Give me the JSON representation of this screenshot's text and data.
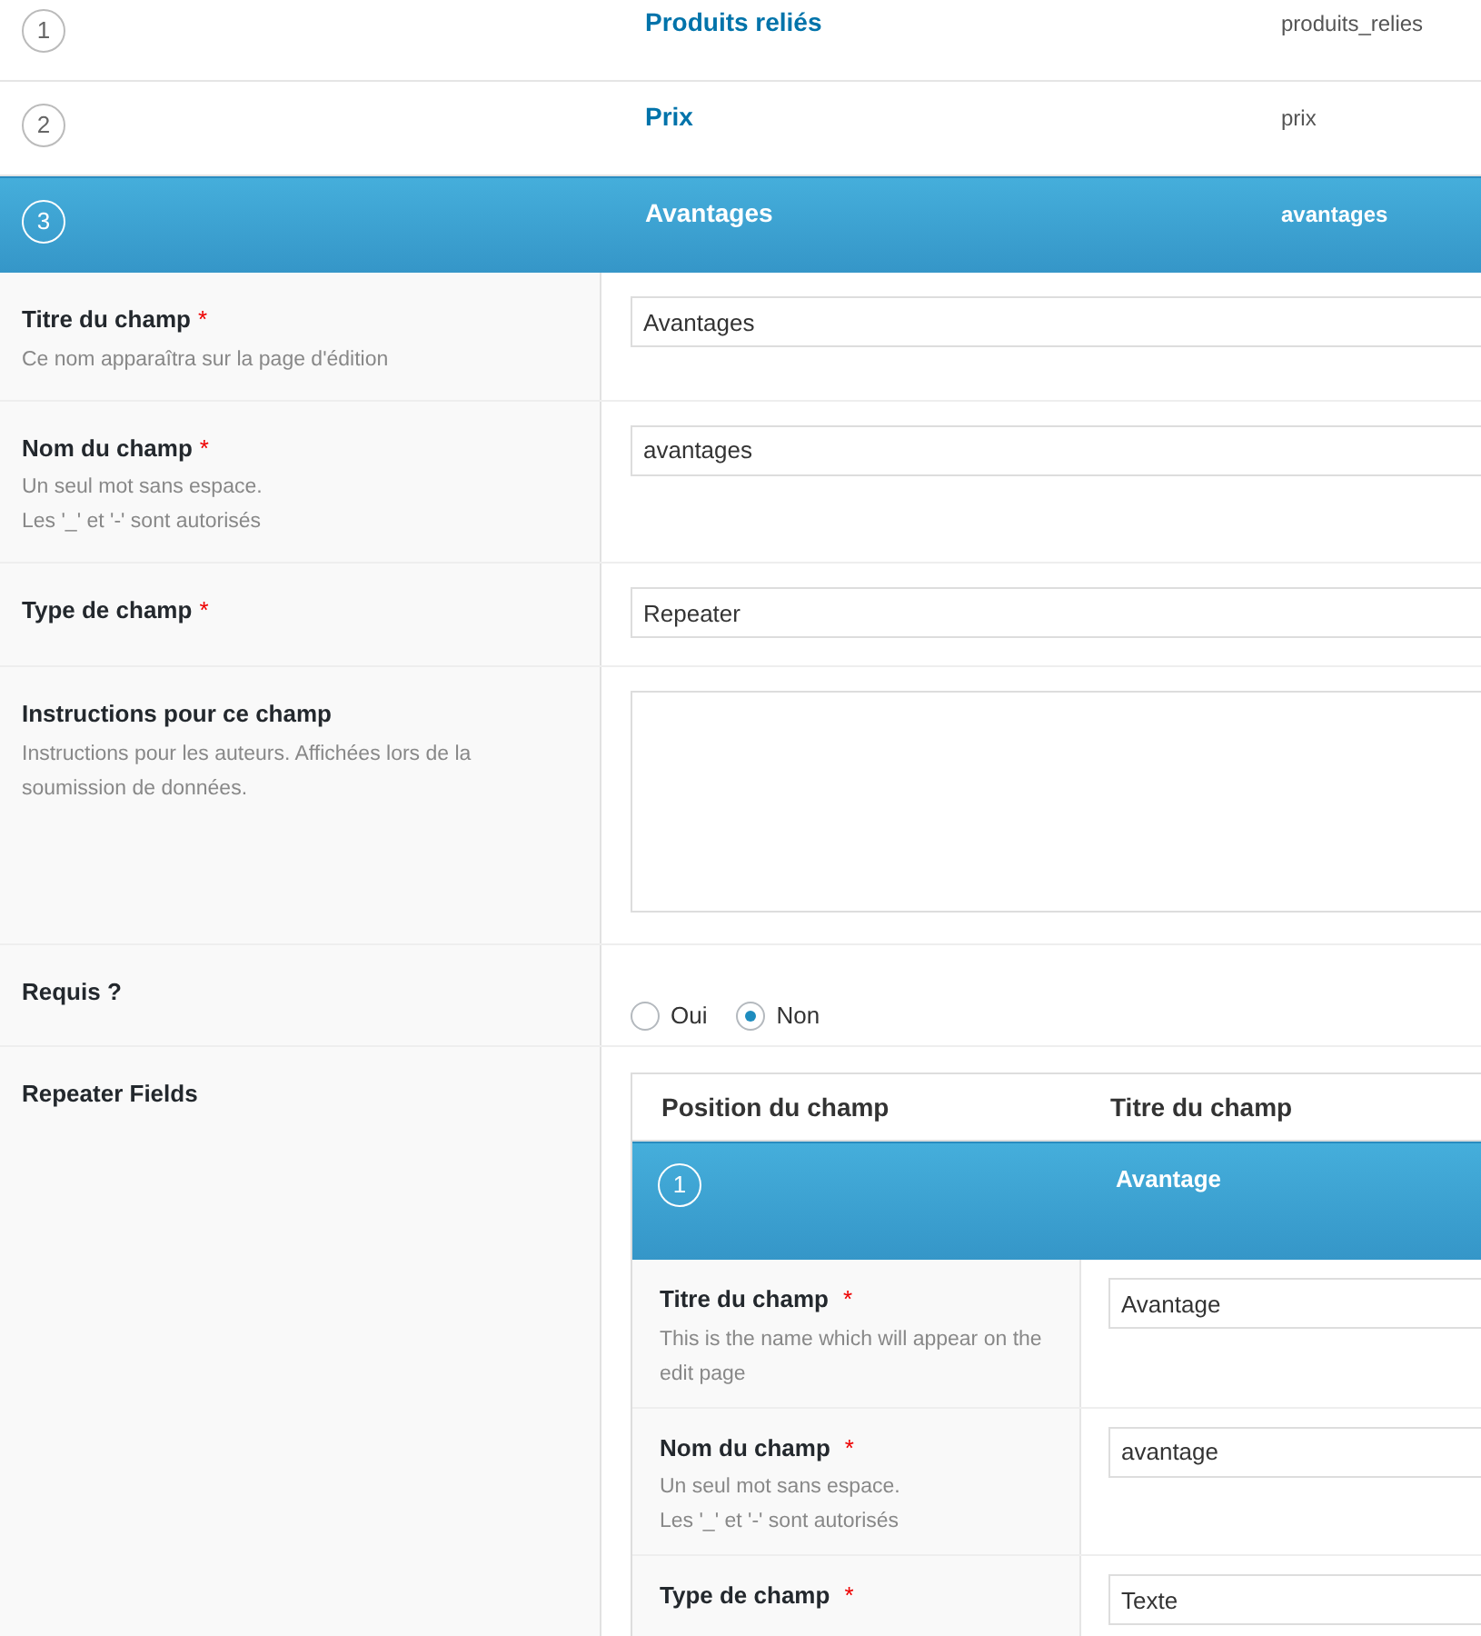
{
  "fields": [
    {
      "number": "1",
      "label": "Produits reliés",
      "name": "produits_relies",
      "selected": false
    },
    {
      "number": "2",
      "label": "Prix",
      "name": "prix",
      "selected": false
    },
    {
      "number": "3",
      "label": "Avantages",
      "name": "avantages",
      "selected": true
    }
  ],
  "settings": [
    {
      "kind": "text",
      "label": "Titre du champ",
      "required_mark": "*",
      "hint_lines": [
        "Ce nom apparaîtra sur la page d'édition"
      ],
      "value": "Avantages"
    },
    {
      "kind": "text",
      "label": "Nom du champ",
      "required_mark": "*",
      "hint_lines": [
        "Un seul mot sans espace.",
        "Les '_' et '-' sont autorisés"
      ],
      "value": "avantages"
    },
    {
      "kind": "text",
      "label": "Type de champ",
      "required_mark": "*",
      "value": "Repeater"
    },
    {
      "kind": "textarea",
      "label": "Instructions pour ce champ",
      "hint_lines": [
        "Instructions pour les auteurs. Affichées lors de la soumission de données."
      ]
    },
    {
      "kind": "radio",
      "label": "Requis ?",
      "options": [
        {
          "label": "Oui",
          "selected": false
        },
        {
          "label": "Non",
          "selected": true
        }
      ]
    },
    {
      "kind": "repeater",
      "label": "Repeater Fields",
      "repeater": {
        "columns": [
          "Position du champ",
          "Titre du champ"
        ],
        "fields": [
          {
            "number": "1",
            "label": "Avantage",
            "selected": true
          }
        ],
        "settings": [
          {
            "label": "Titre du champ",
            "required_mark": "*",
            "hint_lines": [
              "This is the name which will appear on the edit page"
            ],
            "value": "Avantage"
          },
          {
            "label": "Nom du champ",
            "required_mark": "*",
            "hint_lines": [
              "Un seul mot sans espace.",
              "Les '_' et '-' sont autorisés"
            ],
            "value": "avantage"
          },
          {
            "label": "Type de champ",
            "required_mark": "*",
            "value": "Texte"
          }
        ]
      }
    }
  ]
}
